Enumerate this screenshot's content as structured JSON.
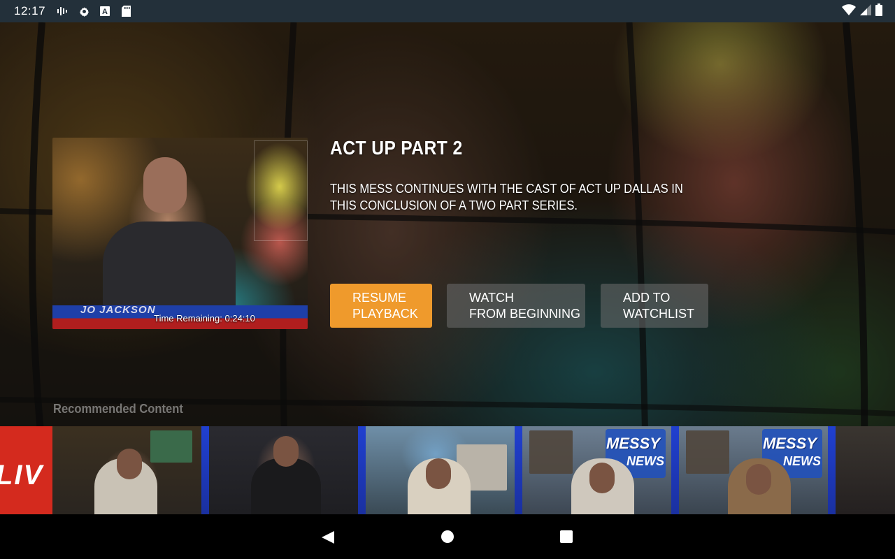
{
  "status_bar": {
    "time": "12:17",
    "left_icons": [
      "signal-bars-icon",
      "gear-icon",
      "a-badge-icon",
      "sd-card-icon"
    ],
    "right_icons": [
      "wifi-icon",
      "cell-signal-icon",
      "battery-icon"
    ]
  },
  "now_playing": {
    "time_remaining": "Time Remaining: 0:24:10",
    "lower_third_name": "JO   JACKSON"
  },
  "details": {
    "title": "ACT UP PART 2",
    "description": "THIS MESS CONTINUES WITH THE CAST OF ACT UP DALLAS IN THIS CONCLUSION OF A TWO PART SERIES."
  },
  "actions": {
    "resume": "RESUME\nPLAYBACK",
    "watch_beginning": "WATCH\nFROM BEGINNING",
    "add_watchlist": "ADD TO\nWATCHLIST"
  },
  "recommended": {
    "label": "Recommended Content",
    "live_text": "LIV",
    "messy_logo_top": "MESSY",
    "messy_logo_bottom": "NEWS"
  },
  "colors": {
    "accent": "#ef9a2c",
    "status_bar": "#23303a",
    "button_secondary": "#6e6e6e"
  },
  "nav_bar": {
    "icons": [
      "back-icon",
      "home-icon",
      "recents-icon"
    ]
  }
}
